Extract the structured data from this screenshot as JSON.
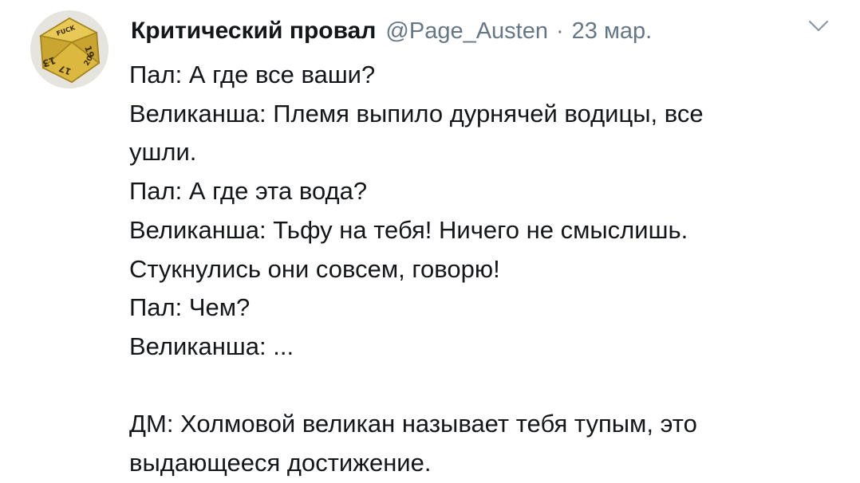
{
  "tweet": {
    "display_name": "Критический провал",
    "handle": "@Page_Austen",
    "separator": "·",
    "date": "23 мар.",
    "avatar": {
      "die_labels": [
        "FUCK",
        "19",
        "13",
        "17",
        "20"
      ]
    },
    "lines": [
      "Пал: А где все ваши?",
      "Великанша: Племя выпило дурнячей водицы, все",
      "ушли.",
      "Пал: А где эта вода?",
      "Великанша: Тьфу на тебя! Ничего не смыслишь.",
      "Стукнулись они совсем, говорю!",
      "Пал: Чем?",
      "Великанша: ...",
      "ДМ: Холмовой великан называет тебя тупым, это",
      "выдающееся достижение."
    ]
  },
  "colors": {
    "text": "#14171a",
    "secondary": "#657786",
    "die_gold": "#d9b43a"
  },
  "icons": {
    "menu": "chevron-down-icon",
    "avatar": "d20-die-avatar"
  }
}
